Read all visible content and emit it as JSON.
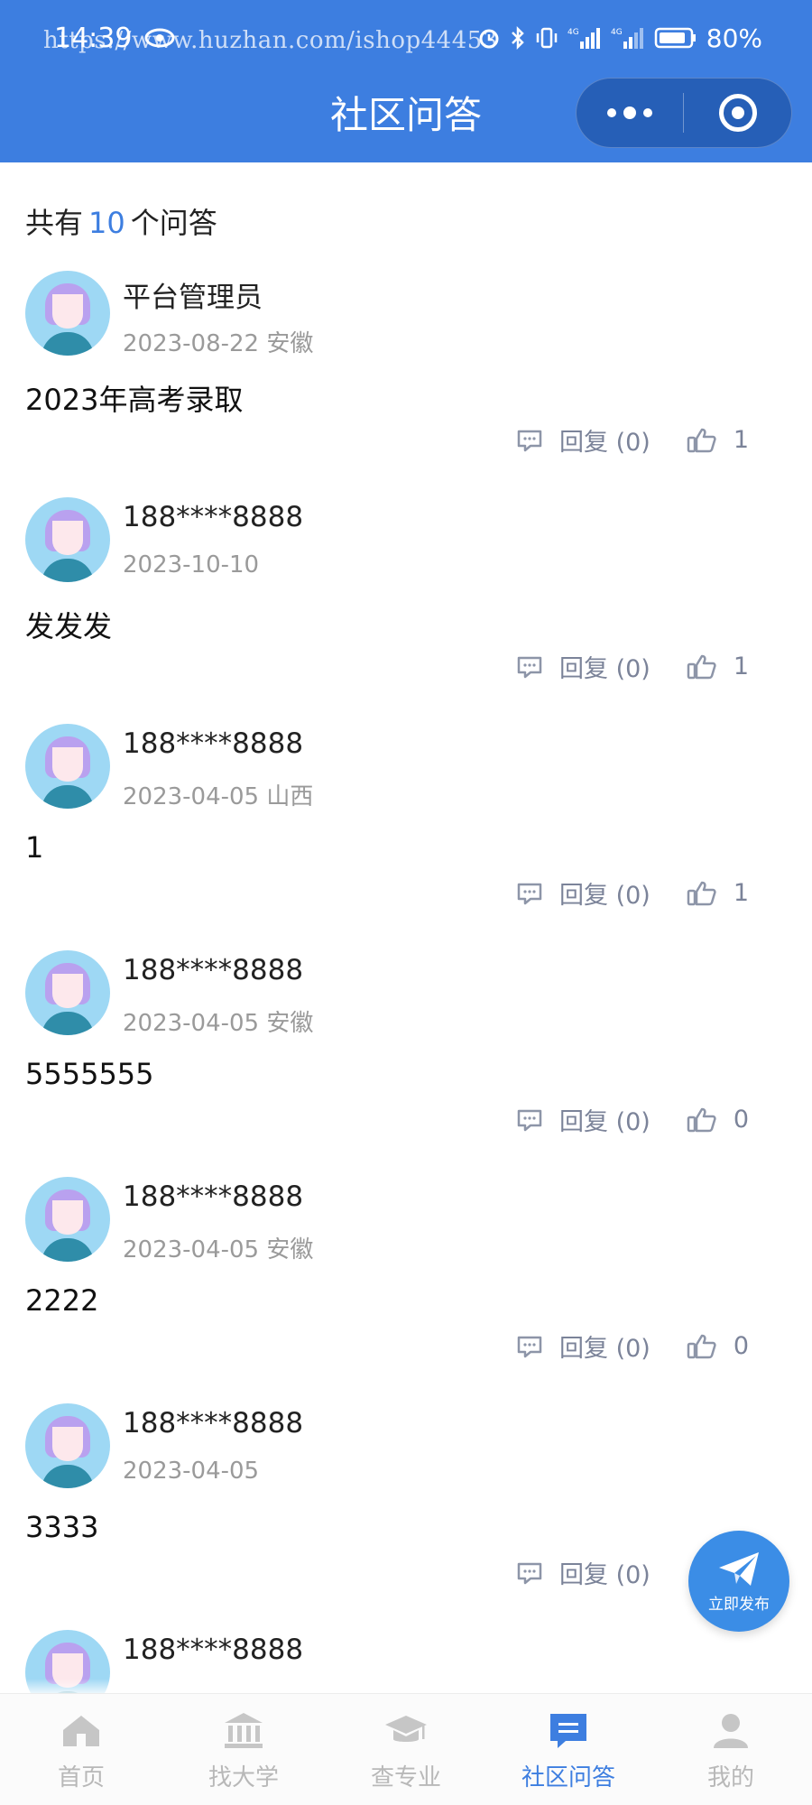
{
  "status_bar": {
    "time": "14:39",
    "battery": "80%",
    "signal_1": "4G",
    "signal_2": "4G"
  },
  "watermark": "https://www.huzhan.com/ishop44453",
  "header": {
    "title": "社区问答"
  },
  "summary": {
    "prefix": "共有",
    "count": "10",
    "suffix": "个问答"
  },
  "posts": [
    {
      "name": "平台管理员",
      "meta": "2023-08-22 安徽",
      "content": "2023年高考录取",
      "reply": "回复 (0)",
      "likes": "1"
    },
    {
      "name": "188****8888",
      "meta": "2023-10-10",
      "content": "发发发",
      "reply": "回复 (0)",
      "likes": "1"
    },
    {
      "name": "188****8888",
      "meta": "2023-04-05 山西",
      "content": "1",
      "reply": "回复 (0)",
      "likes": "1"
    },
    {
      "name": "188****8888",
      "meta": "2023-04-05 安徽",
      "content": "5555555",
      "reply": "回复 (0)",
      "likes": "0"
    },
    {
      "name": "188****8888",
      "meta": "2023-04-05 安徽",
      "content": "2222",
      "reply": "回复 (0)",
      "likes": "0"
    },
    {
      "name": "188****8888",
      "meta": "2023-04-05",
      "content": "3333",
      "reply": "回复 (0)",
      "likes": ""
    },
    {
      "name": "188****8888",
      "meta": "",
      "content": "",
      "reply": "",
      "likes": ""
    }
  ],
  "fab": {
    "label": "立即发布"
  },
  "tabbar": {
    "items": [
      {
        "label": "首页",
        "icon": "home-icon",
        "active": false
      },
      {
        "label": "找大学",
        "icon": "university-icon",
        "active": false
      },
      {
        "label": "查专业",
        "icon": "graduation-cap-icon",
        "active": false
      },
      {
        "label": "社区问答",
        "icon": "chat-bubble-icon",
        "active": true
      },
      {
        "label": "我的",
        "icon": "user-icon",
        "active": false
      }
    ]
  },
  "colors": {
    "accent": "#3d7ee0",
    "fab": "#3b8de6",
    "muted": "#9a9a9a",
    "action": "#7b8399"
  }
}
